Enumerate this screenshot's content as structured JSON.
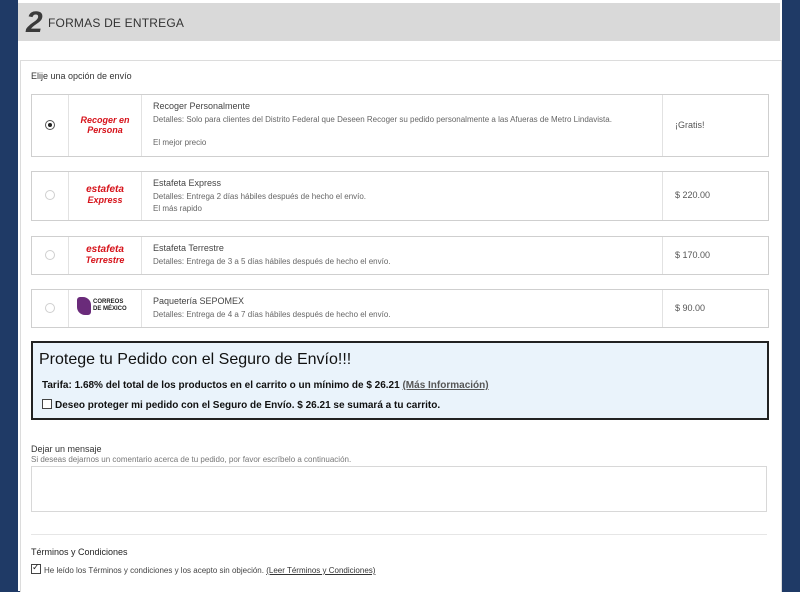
{
  "step": {
    "number": "2",
    "title": "FORMAS DE ENTREGA"
  },
  "shipping": {
    "label": "Elije una opción de envío",
    "options": [
      {
        "selected": true,
        "logo_line1": "Recoger en",
        "logo_line2": "Persona",
        "title": "Recoger Personalmente",
        "detail1": "Detalles: Solo para clientes del Distrito Federal que Deseen Recoger su pedido personalmente a las Afueras de Metro Lindavista.",
        "detail2": "El mejor precio",
        "price": "¡Gratis!"
      },
      {
        "selected": false,
        "logo_line1": "estafeta",
        "logo_line2": "Express",
        "title": "Estafeta Express",
        "detail1": "Detalles: Entrega 2 días hábiles después de hecho el envío.",
        "detail2": "El más rapido",
        "price": "$ 220.00"
      },
      {
        "selected": false,
        "logo_line1": "estafeta",
        "logo_line2": "Terrestre",
        "title": "Estafeta Terrestre",
        "detail1": "Detalles: Entrega de 3 a 5 días hábiles después de hecho el envío.",
        "price": "$ 170.00"
      },
      {
        "selected": false,
        "logo_line1": "CORREOS",
        "logo_line2": "DE MÉXICO",
        "title": "Paquetería SEPOMEX",
        "detail1": "Detalles: Entrega de 4 a 7 días hábiles después de hecho el envío.",
        "price": "$ 90.00"
      }
    ]
  },
  "insurance": {
    "title": "Protege tu Pedido con el Seguro de Envío!!!",
    "rate": "Tarifa: 1.68% del total de los productos en el carrito o un mínimo de $ 26.21",
    "more_info": "(Más Información)",
    "checkbox_label": "Deseo proteger mi pedido con el Seguro de Envío. $ 26.21 se sumará a tu carrito.",
    "checked": false
  },
  "message": {
    "label": "Dejar un mensaje",
    "hint": "Si deseas dejarnos un comentario acerca de tu pedido, por favor escríbelo a continuación.",
    "value": ""
  },
  "terms": {
    "label": "Términos y Condiciones",
    "checkbox_label": "He leído los Términos y condiciones y los acepto sin objeción.",
    "link": "(Leer Términos y Condiciones)",
    "checked": true
  },
  "colors": {
    "page_bg": "#1f3a66",
    "header_bg": "#d9d9d9",
    "insurance_bg": "#eaf3fb",
    "logo_red": "#d6121a",
    "correos_purple": "#6a2b7a"
  }
}
